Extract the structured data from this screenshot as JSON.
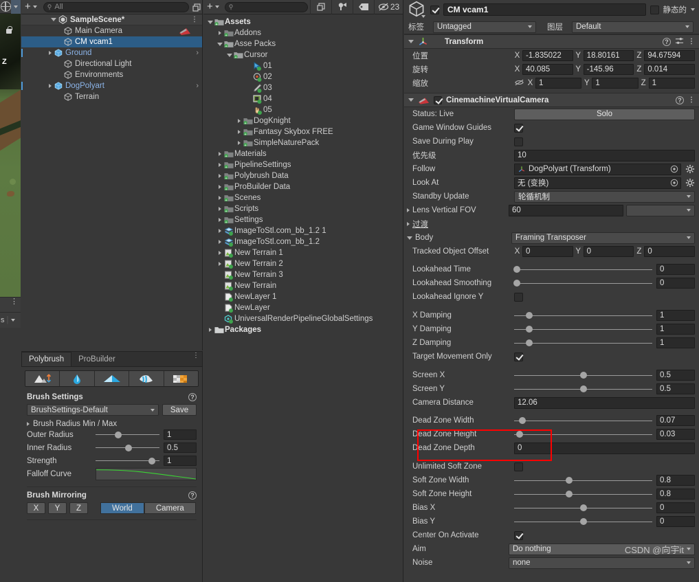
{
  "scene_view": {
    "z_label": "Z",
    "status_suffix": "s"
  },
  "hierarchy": {
    "search_placeholder": "All",
    "add_label": "+",
    "scene_name": "SampleScene*",
    "items": [
      {
        "label": "Main Camera",
        "indent": 2,
        "expandable": false,
        "selected": false,
        "prefab": false,
        "chevron": false,
        "camera_badge": true
      },
      {
        "label": "CM vcam1",
        "indent": 2,
        "expandable": false,
        "selected": true,
        "prefab": false,
        "chevron": false,
        "camera_badge": false
      },
      {
        "label": "Ground",
        "indent": 1,
        "expandable": true,
        "selected": false,
        "prefab": true,
        "chevron": true,
        "camera_badge": false
      },
      {
        "label": "Directional Light",
        "indent": 2,
        "expandable": false,
        "selected": false,
        "prefab": false,
        "chevron": false,
        "camera_badge": false
      },
      {
        "label": "Environments",
        "indent": 2,
        "expandable": false,
        "selected": false,
        "prefab": false,
        "chevron": false,
        "camera_badge": false
      },
      {
        "label": "DogPolyart",
        "indent": 1,
        "expandable": true,
        "selected": false,
        "prefab": true,
        "chevron": true,
        "camera_badge": false
      },
      {
        "label": "Terrain",
        "indent": 2,
        "expandable": false,
        "selected": false,
        "prefab": false,
        "chevron": false,
        "camera_badge": false
      }
    ]
  },
  "polybrush": {
    "tabs": [
      {
        "label": "Polybrush",
        "active": true
      },
      {
        "label": "ProBuilder",
        "active": false
      }
    ],
    "modes": [
      "sculpt-icon",
      "smooth-icon",
      "color-icon",
      "texture-blend-icon",
      "prefab-scatter-icon"
    ],
    "brush_settings": {
      "title": "Brush Settings",
      "preset": "BrushSettings-Default",
      "save_label": "Save",
      "radius_foldout": "Brush Radius Min / Max",
      "rows": [
        {
          "label": "Outer Radius",
          "value": "1",
          "knob_pct": 35
        },
        {
          "label": "Inner Radius",
          "value": "0.5",
          "knob_pct": 52
        },
        {
          "label": "Strength",
          "value": "1",
          "knob_pct": 88
        }
      ],
      "curve_label": "Falloff Curve"
    },
    "brush_mirroring": {
      "title": "Brush Mirroring",
      "axes": [
        "X",
        "Y",
        "Z"
      ],
      "space_options": [
        {
          "label": "World",
          "selected": true
        },
        {
          "label": "Camera",
          "selected": false
        }
      ]
    }
  },
  "project": {
    "search_placeholder": "",
    "add_label": "+",
    "badge_count": "23",
    "rows": [
      {
        "label": "Assets",
        "indent": 0,
        "arrow": "down",
        "icon": "folder-green",
        "bold": true
      },
      {
        "label": "Addons",
        "indent": 1,
        "arrow": "right",
        "icon": "folder-green-dark",
        "bold": false
      },
      {
        "label": "Asse Packs",
        "indent": 1,
        "arrow": "down",
        "icon": "folder-green",
        "bold": false
      },
      {
        "label": "Cursor",
        "indent": 2,
        "arrow": "down",
        "icon": "folder-green",
        "bold": false
      },
      {
        "label": "01",
        "indent": 4,
        "arrow": "none",
        "icon": "cursor-arrow",
        "bold": false
      },
      {
        "label": "02",
        "indent": 4,
        "arrow": "none",
        "icon": "cursor-target",
        "bold": false
      },
      {
        "label": "03",
        "indent": 4,
        "arrow": "none",
        "icon": "cursor-sword",
        "bold": false
      },
      {
        "label": "04",
        "indent": 4,
        "arrow": "none",
        "icon": "cursor-bracket",
        "bold": false
      },
      {
        "label": "05",
        "indent": 4,
        "arrow": "none",
        "icon": "cursor-hand",
        "bold": false
      },
      {
        "label": "DogKnight",
        "indent": 3,
        "arrow": "right",
        "icon": "folder-green-dark",
        "bold": false
      },
      {
        "label": "Fantasy Skybox FREE",
        "indent": 3,
        "arrow": "right",
        "icon": "folder-green-dark",
        "bold": false
      },
      {
        "label": "SimpleNaturePack",
        "indent": 3,
        "arrow": "right",
        "icon": "folder-green-dark",
        "bold": false
      },
      {
        "label": "Materials",
        "indent": 1,
        "arrow": "right",
        "icon": "folder-green-dark",
        "bold": false
      },
      {
        "label": "PipelineSettings",
        "indent": 1,
        "arrow": "right",
        "icon": "folder-green-dark",
        "bold": false
      },
      {
        "label": "Polybrush Data",
        "indent": 1,
        "arrow": "right",
        "icon": "folder-green-dark",
        "bold": false
      },
      {
        "label": "ProBuilder Data",
        "indent": 1,
        "arrow": "right",
        "icon": "folder-green-dark",
        "bold": false
      },
      {
        "label": "Scenes",
        "indent": 1,
        "arrow": "right",
        "icon": "folder-green-dark",
        "bold": false
      },
      {
        "label": "Scripts",
        "indent": 1,
        "arrow": "right",
        "icon": "folder-green-dark",
        "bold": false
      },
      {
        "label": "Settings",
        "indent": 1,
        "arrow": "right",
        "icon": "folder-green-dark",
        "bold": false
      },
      {
        "label": "ImageToStl.com_bb_1.2 1",
        "indent": 1,
        "arrow": "right",
        "icon": "mesh-asset",
        "bold": false
      },
      {
        "label": "ImageToStl.com_bb_1.2",
        "indent": 1,
        "arrow": "right",
        "icon": "mesh-asset",
        "bold": false
      },
      {
        "label": "New Terrain 1",
        "indent": 1,
        "arrow": "right",
        "icon": "terrain-asset",
        "bold": false
      },
      {
        "label": "New Terrain 2",
        "indent": 1,
        "arrow": "right",
        "icon": "terrain-asset",
        "bold": false
      },
      {
        "label": "New Terrain 3",
        "indent": 1,
        "arrow": "none",
        "icon": "terrain-asset",
        "bold": false
      },
      {
        "label": "New Terrain",
        "indent": 1,
        "arrow": "none",
        "icon": "terrain-asset",
        "bold": false
      },
      {
        "label": "NewLayer 1",
        "indent": 1,
        "arrow": "none",
        "icon": "layer-asset",
        "bold": false
      },
      {
        "label": "NewLayer",
        "indent": 1,
        "arrow": "none",
        "icon": "layer-asset",
        "bold": false
      },
      {
        "label": "UniversalRenderPipelineGlobalSettings",
        "indent": 1,
        "arrow": "none",
        "icon": "settings-asset",
        "bold": false
      },
      {
        "label": "Packages",
        "indent": 0,
        "arrow": "right",
        "icon": "folder-plain",
        "bold": true
      }
    ]
  },
  "inspector": {
    "object_name": "CM vcam1",
    "enabled": true,
    "static_label": "静态的",
    "static_checked": false,
    "tag_label": "标签",
    "tag_value": "Untagged",
    "layer_label": "图层",
    "layer_value": "Default",
    "transform": {
      "title": "Transform",
      "position_label": "位置",
      "rotation_label": "旋转",
      "scale_label": "缩放",
      "position": {
        "x": "-1.835022",
        "y": "18.80161",
        "z": "94.67594"
      },
      "rotation": {
        "x": "40.085",
        "y": "-145.96",
        "z": "0.014"
      },
      "scale": {
        "x": "1",
        "y": "1",
        "z": "1"
      }
    },
    "vcam": {
      "title": "CinemachineVirtualCamera",
      "enabled": true,
      "status_label": "Status: Live",
      "solo_label": "Solo",
      "game_window_guides_label": "Game Window Guides",
      "game_window_guides": true,
      "save_during_play_label": "Save During Play",
      "save_during_play": false,
      "priority_label": "优先级",
      "priority_value": "10",
      "follow_label": "Follow",
      "follow_value": "DogPolyart (Transform)",
      "look_at_label": "Look At",
      "look_at_value": "无 (变换)",
      "standby_label": "Standby Update",
      "standby_value": "轮循机制",
      "lens_label": "Lens Vertical FOV",
      "lens_value": "60",
      "transitions_label": "过渡",
      "body_label": "Body",
      "body_value": "Framing Transposer",
      "tracked_offset_label": "Tracked Object Offset",
      "tracked_offset": {
        "x": "0",
        "y": "0",
        "z": "0"
      },
      "sliders": [
        {
          "label": "Lookahead Time",
          "value": "0",
          "knob_pct": 2
        },
        {
          "label": "Lookahead Smoothing",
          "value": "0",
          "knob_pct": 2
        }
      ],
      "lookahead_ignore_y_label": "Lookahead Ignore Y",
      "lookahead_ignore_y": false,
      "damping": [
        {
          "label": "X Damping",
          "value": "1",
          "knob_pct": 11
        },
        {
          "label": "Y Damping",
          "value": "1",
          "knob_pct": 11
        },
        {
          "label": "Z Damping",
          "value": "1",
          "knob_pct": 11
        }
      ],
      "target_movement_only_label": "Target Movement Only",
      "target_movement_only": true,
      "screen": [
        {
          "label": "Screen X",
          "value": "0.5",
          "knob_pct": 50
        },
        {
          "label": "Screen Y",
          "value": "0.5",
          "knob_pct": 50
        }
      ],
      "camera_distance_label": "Camera Distance",
      "camera_distance_value": "12.06",
      "dead_zone": [
        {
          "label": "Dead Zone Width",
          "value": "0.07",
          "knob_pct": 6
        },
        {
          "label": "Dead Zone Height",
          "value": "0.03",
          "knob_pct": 4
        }
      ],
      "dead_zone_depth_label": "Dead Zone Depth",
      "dead_zone_depth_value": "0",
      "unlimited_soft_zone_label": "Unlimited Soft Zone",
      "unlimited_soft_zone": false,
      "soft_zone": [
        {
          "label": "Soft Zone Width",
          "value": "0.8",
          "knob_pct": 40
        },
        {
          "label": "Soft Zone Height",
          "value": "0.8",
          "knob_pct": 40
        },
        {
          "label": "Bias X",
          "value": "0",
          "knob_pct": 50
        },
        {
          "label": "Bias Y",
          "value": "0",
          "knob_pct": 50
        }
      ],
      "center_on_activate_label": "Center On Activate",
      "center_on_activate": true,
      "aim_label": "Aim",
      "aim_value": "Do nothing",
      "noise_label": "Noise",
      "noise_value": "none"
    },
    "watermark": "CSDN @向宇it"
  }
}
